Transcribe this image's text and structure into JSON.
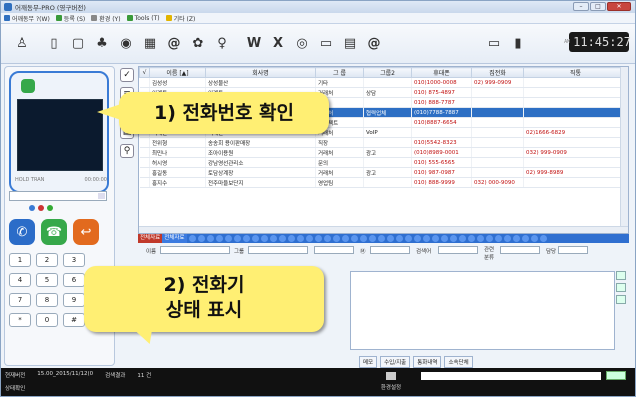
{
  "window": {
    "title": "어깨동무-PRO (영구버전)"
  },
  "menu": [
    {
      "label": "어깨동무 ?(W)",
      "color": "#2f6fbf"
    },
    {
      "label": "등록 (S)",
      "color": "#3a9a3a"
    },
    {
      "label": "환경 (Y)",
      "color": "#888"
    },
    {
      "label": "Tools (T)",
      "color": "#3a9a3a"
    },
    {
      "label": "기타 (Z)",
      "color": "#e2b400"
    }
  ],
  "toolbar": {
    "icons": [
      {
        "name": "user-icon",
        "glyph": "♙"
      },
      {
        "name": "phone-icon",
        "glyph": "▯"
      },
      {
        "name": "memo-icon",
        "glyph": "▢"
      },
      {
        "name": "group-icon",
        "glyph": "♣"
      },
      {
        "name": "disc-icon",
        "glyph": "◉"
      },
      {
        "name": "calendar-icon",
        "glyph": "▦"
      },
      {
        "name": "email-icon",
        "glyph": "@"
      },
      {
        "name": "settings-icon",
        "glyph": "✿"
      },
      {
        "name": "person-icon",
        "glyph": "♀"
      },
      {
        "name": "word-icon",
        "glyph": "W"
      },
      {
        "name": "excel-icon",
        "glyph": "X"
      },
      {
        "name": "web-icon",
        "glyph": "◎"
      },
      {
        "name": "sms-icon",
        "glyph": "▭"
      },
      {
        "name": "note-icon",
        "glyph": "▤"
      },
      {
        "name": "at-icon",
        "glyph": "@"
      }
    ],
    "right_icons": [
      {
        "name": "monitor-icon",
        "glyph": "▭"
      },
      {
        "name": "exit-icon",
        "glyph": "▮"
      }
    ]
  },
  "clock": {
    "ampm": "AM",
    "time": "11:45:27"
  },
  "phone": {
    "status_left": "HOLD  TRAN",
    "status_right": "00:00:00"
  },
  "keypad": [
    "1",
    "2",
    "3",
    "4",
    "5",
    "6",
    "7",
    "8",
    "9",
    "*",
    "0",
    "#"
  ],
  "contacts": {
    "columns": [
      "√",
      "이름 [▲]",
      "회사명",
      "그 룹",
      "그룹2",
      "휴대폰",
      "집전화",
      "직통"
    ],
    "rows": [
      [
        "",
        "김성성",
        "상성물산",
        "기타",
        "",
        "010)1000-0008",
        "02) 999-0909",
        ""
      ],
      [
        "",
        "이계동",
        "이계동",
        "거래처",
        "상담",
        "010) 875-4897",
        "",
        ""
      ],
      [
        "",
        "유기영",
        "유기영",
        "기타",
        "",
        "010) 888-7787",
        "",
        ""
      ],
      [
        "",
        "동이",
        "동이",
        "거래처",
        "협력업체",
        "(010)7788-7887",
        "",
        ""
      ],
      [
        "",
        "쪼코쪼코",
        "쪼코쪼코",
        "프로젝트",
        "",
        "010)8887-6654",
        "",
        ""
      ],
      [
        "",
        "백대인",
        "백대인",
        "거래처",
        "VoIP",
        "",
        "",
        "02)1666-6829"
      ],
      [
        "",
        "전위형",
        "송송회 용이판매장",
        "직장",
        "",
        "010)5542-8323",
        "",
        ""
      ],
      [
        "",
        "최민나",
        "조아이용원",
        "거래처",
        "광고",
        "(010)8989-0001",
        "",
        "032) 999-0909"
      ],
      [
        "",
        "허시영",
        "강남영선관리소",
        "문의",
        "",
        "010) 555-6565",
        "",
        ""
      ],
      [
        "",
        "홍길동",
        "토담상계장",
        "거래처",
        "광고",
        "010) 987-0987",
        "",
        "02) 999-8989"
      ],
      [
        "",
        "홍지수",
        "전주마을보단지",
        "영업팀",
        "",
        "010) 888-9999",
        "032) 000-9090",
        ""
      ]
    ]
  },
  "alphabar": {
    "tab1": "전체자료",
    "tab2": "전체자료",
    "letters": "ㄱㄴㄷㄹㅁㅂㅅㅇㅈㅊㅋㅌㅍㅎABCDEFGHIJKLMNOPQRSTUVWXYZ"
  },
  "form": {
    "name_label": "이름",
    "group_label": "그룹",
    "email_label": "Ⓜ",
    "search_label": "검색어",
    "category_label": "관련 분류",
    "manager_label": "담당"
  },
  "tabs": [
    "메모",
    "수입/지출",
    "통화내역",
    "소속단체"
  ],
  "statusbar": {
    "version_label": "현재버전",
    "version_value": "15.00_2015/11/12(0",
    "search_label": "검색결과",
    "search_value": "11 건",
    "status": "상태확인",
    "config": "환경설정"
  },
  "callouts": {
    "one": "1) 전화번호 확인",
    "two_line1": "2) 전화기",
    "two_line2": "상태 표시"
  }
}
